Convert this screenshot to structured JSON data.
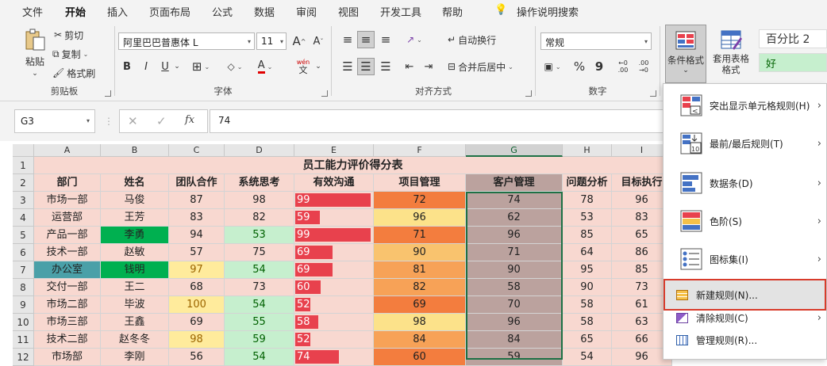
{
  "tabs": [
    "文件",
    "开始",
    "插入",
    "页面布局",
    "公式",
    "数据",
    "审阅",
    "视图",
    "开发工具",
    "帮助",
    "操作说明搜索"
  ],
  "ribbon": {
    "clipboard": {
      "paste": "粘贴",
      "cut": "剪切",
      "copy": "复制",
      "format_painter": "格式刷",
      "label": "剪贴板"
    },
    "font": {
      "name": "阿里巴巴普惠体 L",
      "size": "11",
      "grow": "A",
      "shrink": "A",
      "bold": "B",
      "italic": "I",
      "underline": "U",
      "phonetic": "wén",
      "label": "字体"
    },
    "alignment": {
      "wrap": "自动换行",
      "merge": "合并后居中",
      "label": "对齐方式"
    },
    "number": {
      "format": "常规",
      "percent": "%",
      "comma": "9",
      "dec_inc": "←0 .00",
      "dec_dec": ".00 →0",
      "label": "数字"
    },
    "styles": {
      "cond_format": "条件格式",
      "table_format": "套用表格格式",
      "style1": "百分比 2",
      "style2": "好"
    }
  },
  "formula_bar": {
    "cell": "G3",
    "fx": "fx",
    "value": "74"
  },
  "sheet": {
    "columns": [
      "A",
      "B",
      "C",
      "D",
      "E",
      "F",
      "G",
      "H",
      "I"
    ],
    "rows": [
      "1",
      "2",
      "3",
      "4",
      "5",
      "6",
      "7",
      "8",
      "9",
      "10",
      "11",
      "12"
    ],
    "title": "员工能力评价得分表",
    "headers": [
      "部门",
      "姓名",
      "团队合作",
      "系统思考",
      "有效沟通",
      "项目管理",
      "客户管理",
      "问题分析",
      "目标执行"
    ],
    "data": [
      [
        "市场一部",
        "马俊",
        "87",
        "98",
        "99",
        "72",
        "74",
        "78",
        "96"
      ],
      [
        "运营部",
        "王芳",
        "83",
        "82",
        "59",
        "96",
        "62",
        "53",
        "83"
      ],
      [
        "产品一部",
        "李勇",
        "94",
        "53",
        "99",
        "71",
        "96",
        "85",
        "65"
      ],
      [
        "技术一部",
        "赵敏",
        "57",
        "75",
        "69",
        "90",
        "71",
        "64",
        "86"
      ],
      [
        "办公室",
        "钱明",
        "97",
        "54",
        "69",
        "81",
        "90",
        "95",
        "85"
      ],
      [
        "交付一部",
        "王二",
        "68",
        "73",
        "60",
        "82",
        "58",
        "90",
        "73"
      ],
      [
        "市场二部",
        "毕波",
        "100",
        "54",
        "52",
        "69",
        "70",
        "58",
        "61"
      ],
      [
        "市场三部",
        "王鑫",
        "69",
        "55",
        "58",
        "98",
        "96",
        "58",
        "63"
      ],
      [
        "技术二部",
        "赵冬冬",
        "98",
        "59",
        "52",
        "84",
        "84",
        "65",
        "66"
      ],
      [
        "市场部",
        "李刚",
        "56",
        "54",
        "74",
        "60",
        "59",
        "54",
        "96"
      ]
    ]
  },
  "cf_menu": {
    "items": [
      {
        "label": "突出显示单元格规则(H)",
        "arrow": true
      },
      {
        "label": "最前/最后规则(T)",
        "arrow": true
      },
      {
        "label": "数据条(D)",
        "arrow": true
      },
      {
        "label": "色阶(S)",
        "arrow": true
      },
      {
        "label": "图标集(I)",
        "arrow": true
      },
      {
        "label": "新建规则(N)...",
        "arrow": false
      },
      {
        "label": "清除规则(C)",
        "arrow": true
      },
      {
        "label": "管理规则(R)...",
        "arrow": false
      }
    ]
  },
  "colors": {
    "accent": "#1e7145",
    "row_bg": "#f8d8d0",
    "databar": "#e8414d",
    "green": "#00b050",
    "teal": "#4aa0a8",
    "g_col": "#bba29e",
    "highlight_border": "#d83b2b"
  }
}
